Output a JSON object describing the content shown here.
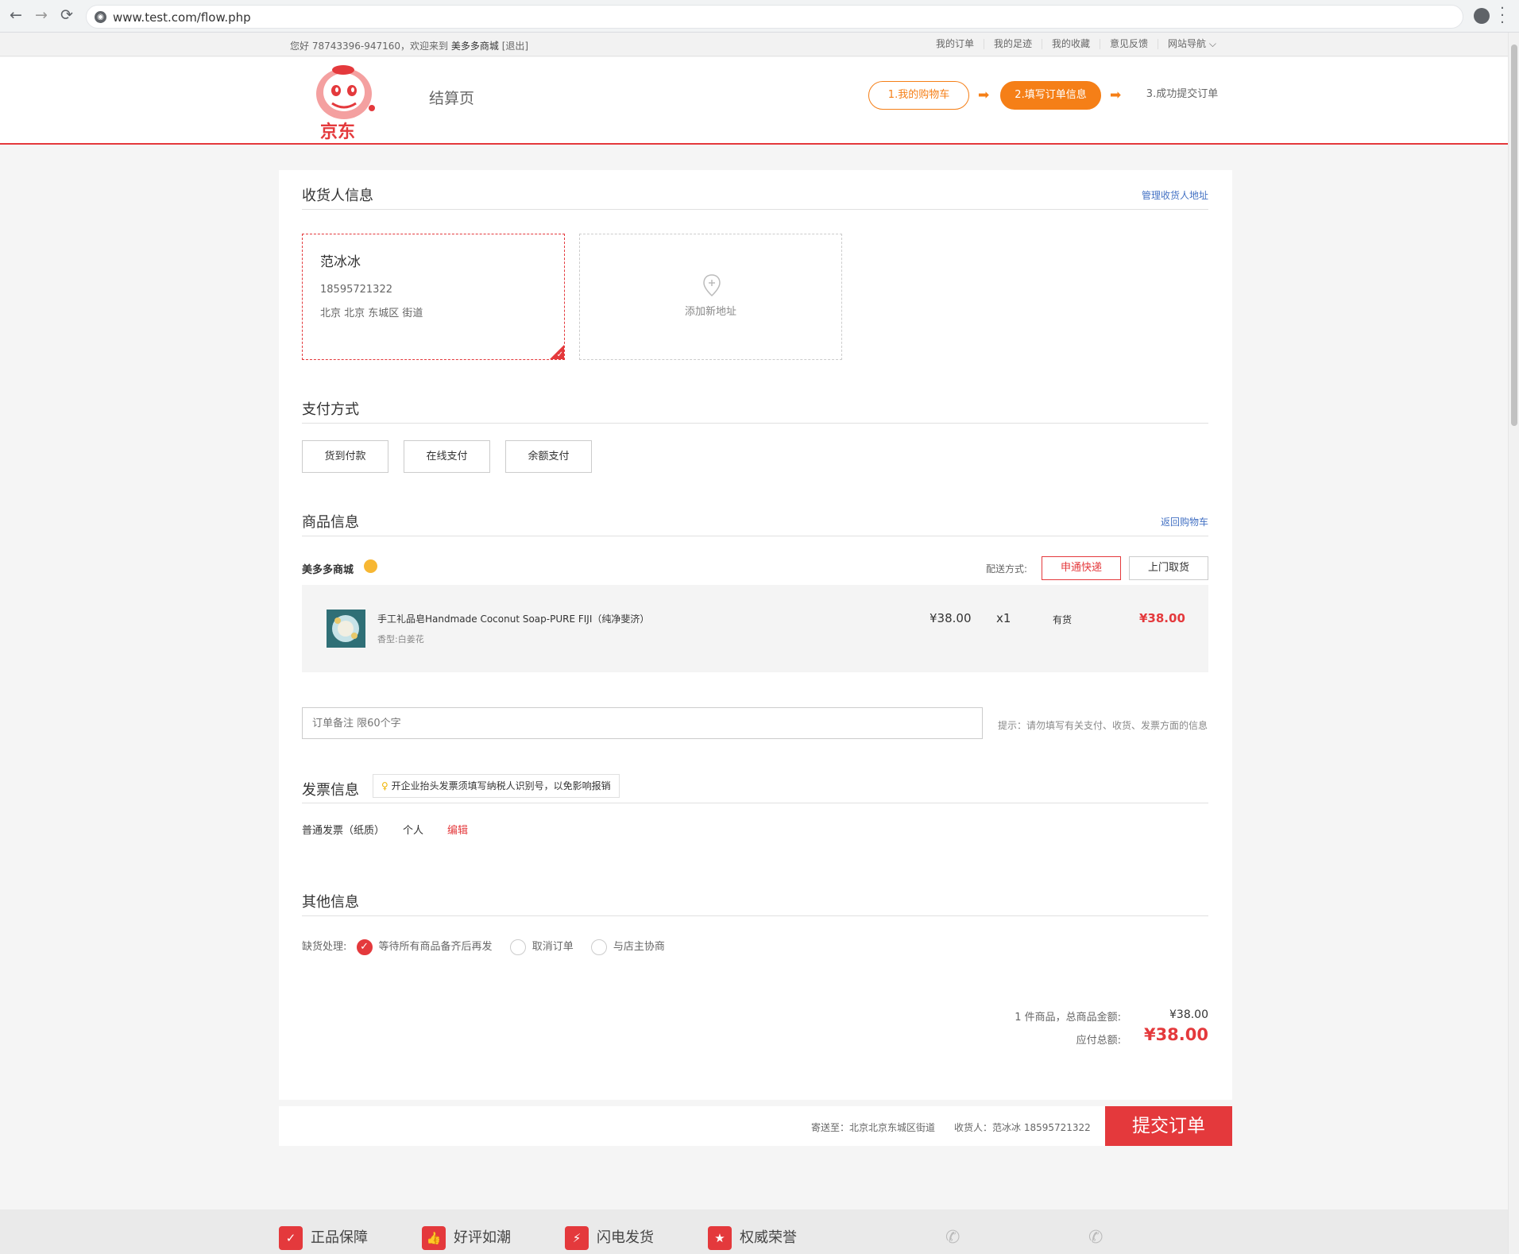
{
  "browser": {
    "back_glyph": "←",
    "forward_glyph": "→",
    "reload_glyph": "⟳",
    "url": "www.test.com/flow.php"
  },
  "topbar": {
    "greeting_prefix": "您好  78743396-947160，欢迎来到",
    "shop_name": "美多多商城",
    "logout": "[退出]",
    "links": [
      "我的订单",
      "我的足迹",
      "我的收藏",
      "意见反馈",
      "网站导航"
    ]
  },
  "header": {
    "logo_text": "京东",
    "page_title": "结算页",
    "steps": [
      "1.我的购物车",
      "2.填写订单信息",
      "3.成功提交订单"
    ],
    "arrow_glyph": "➡"
  },
  "receiver": {
    "title": "收货人信息",
    "manage_link": "管理收货人地址",
    "name": "范冰冰",
    "phone": "18595721322",
    "address": "北京 北京 东城区   街道",
    "add_new": "添加新地址",
    "check_glyph": "✓"
  },
  "payment": {
    "title": "支付方式",
    "options": [
      "货到付款",
      "在线支付",
      "余额支付"
    ]
  },
  "goods": {
    "title": "商品信息",
    "back_link": "返回购物车",
    "shop_name": "美多多商城",
    "delivery_label": "配送方式:",
    "delivery_options": [
      "申通快递",
      "上门取货"
    ],
    "item": {
      "name": "手工礼品皂Handmade Coconut Soap-PURE FIJI（纯净斐济）",
      "spec": "香型:白姜花",
      "price": "¥38.00",
      "qty": "x1",
      "stock": "有货",
      "subtotal": "¥38.00"
    }
  },
  "note": {
    "placeholder": "订单备注 限60个字",
    "hint": "提示：请勿填写有关支付、收货、发票方面的信息"
  },
  "invoice": {
    "title": "发票信息",
    "tip": "开企业抬头发票须填写纳税人识别号，以免影响报销",
    "type": "普通发票（纸质）",
    "header": "个人",
    "edit": "编辑"
  },
  "other": {
    "title": "其他信息",
    "label": "缺货处理:",
    "options": [
      "等待所有商品备齐后再发",
      "取消订单",
      "与店主协商"
    ],
    "check_glyph": "✓"
  },
  "summary": {
    "goods_label": "1 件商品，总商品金额:",
    "goods_amount": "¥38.00",
    "payable_label": "应付总额:",
    "payable_amount": "¥38.00"
  },
  "submit_bar": {
    "ship_to": "寄送至：北京北京东城区街道",
    "receiver": "收货人：范冰冰  18595721322",
    "submit": "提交订单"
  },
  "footer": {
    "items": [
      "正品保障",
      "好评如潮",
      "闪电发货",
      "权威荣誉"
    ],
    "icon_glyphs": [
      "✓",
      "👍",
      "⚡",
      "★"
    ],
    "phone_glyph": "✆"
  },
  "colors": {
    "brand_red": "#e4393c",
    "step_orange": "#f57f17",
    "link_blue": "#4472c4"
  }
}
